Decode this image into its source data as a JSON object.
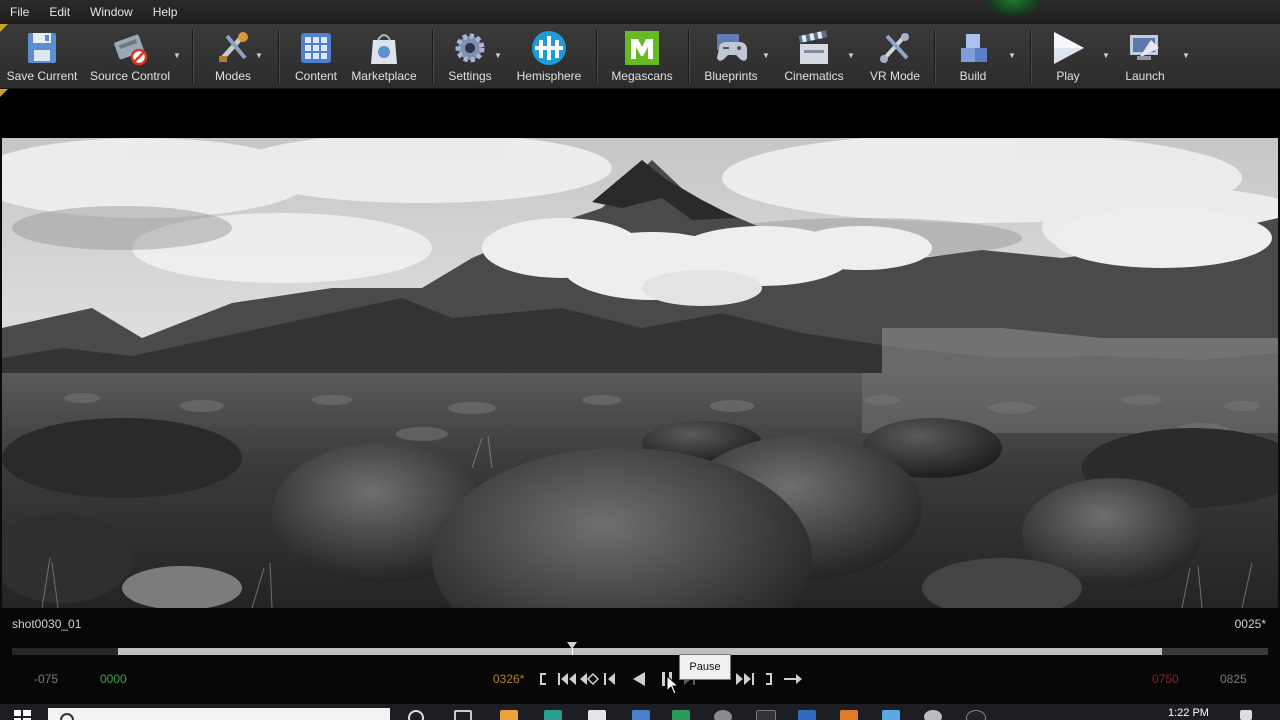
{
  "menu": [
    "File",
    "Edit",
    "Window",
    "Help"
  ],
  "toolbar": {
    "save_current": "Save Current",
    "source_control": "Source Control",
    "modes": "Modes",
    "content": "Content",
    "marketplace": "Marketplace",
    "settings": "Settings",
    "hemisphere": "Hemisphere",
    "megascans": "Megascans",
    "blueprints": "Blueprints",
    "cinematics": "Cinematics",
    "vr_mode": "VR Mode",
    "build": "Build",
    "play": "Play",
    "launch": "Launch"
  },
  "sequencer": {
    "shot_name": "shot0030_01",
    "current_frame": "0025*",
    "tc_view_start": "-075",
    "tc_work_start": "0000",
    "tc_playhead": "0326*",
    "tc_work_end": "0750",
    "tc_view_end": "0825",
    "playback_range_start": 0.084,
    "playhead_position": 0.446,
    "playback_range_end": 0.916
  },
  "tooltip": {
    "text": "Pause"
  },
  "taskbar": {
    "clock": "1:22 PM"
  },
  "colors": {
    "tc_normal": "#8a8a8a",
    "tc_start_green": "#35a845",
    "tc_playhead_orange": "#b0802e",
    "tc_end_red": "#8a2323",
    "megascans_green": "#66bb22",
    "hemisphere_blue": "#1e9ad6"
  }
}
